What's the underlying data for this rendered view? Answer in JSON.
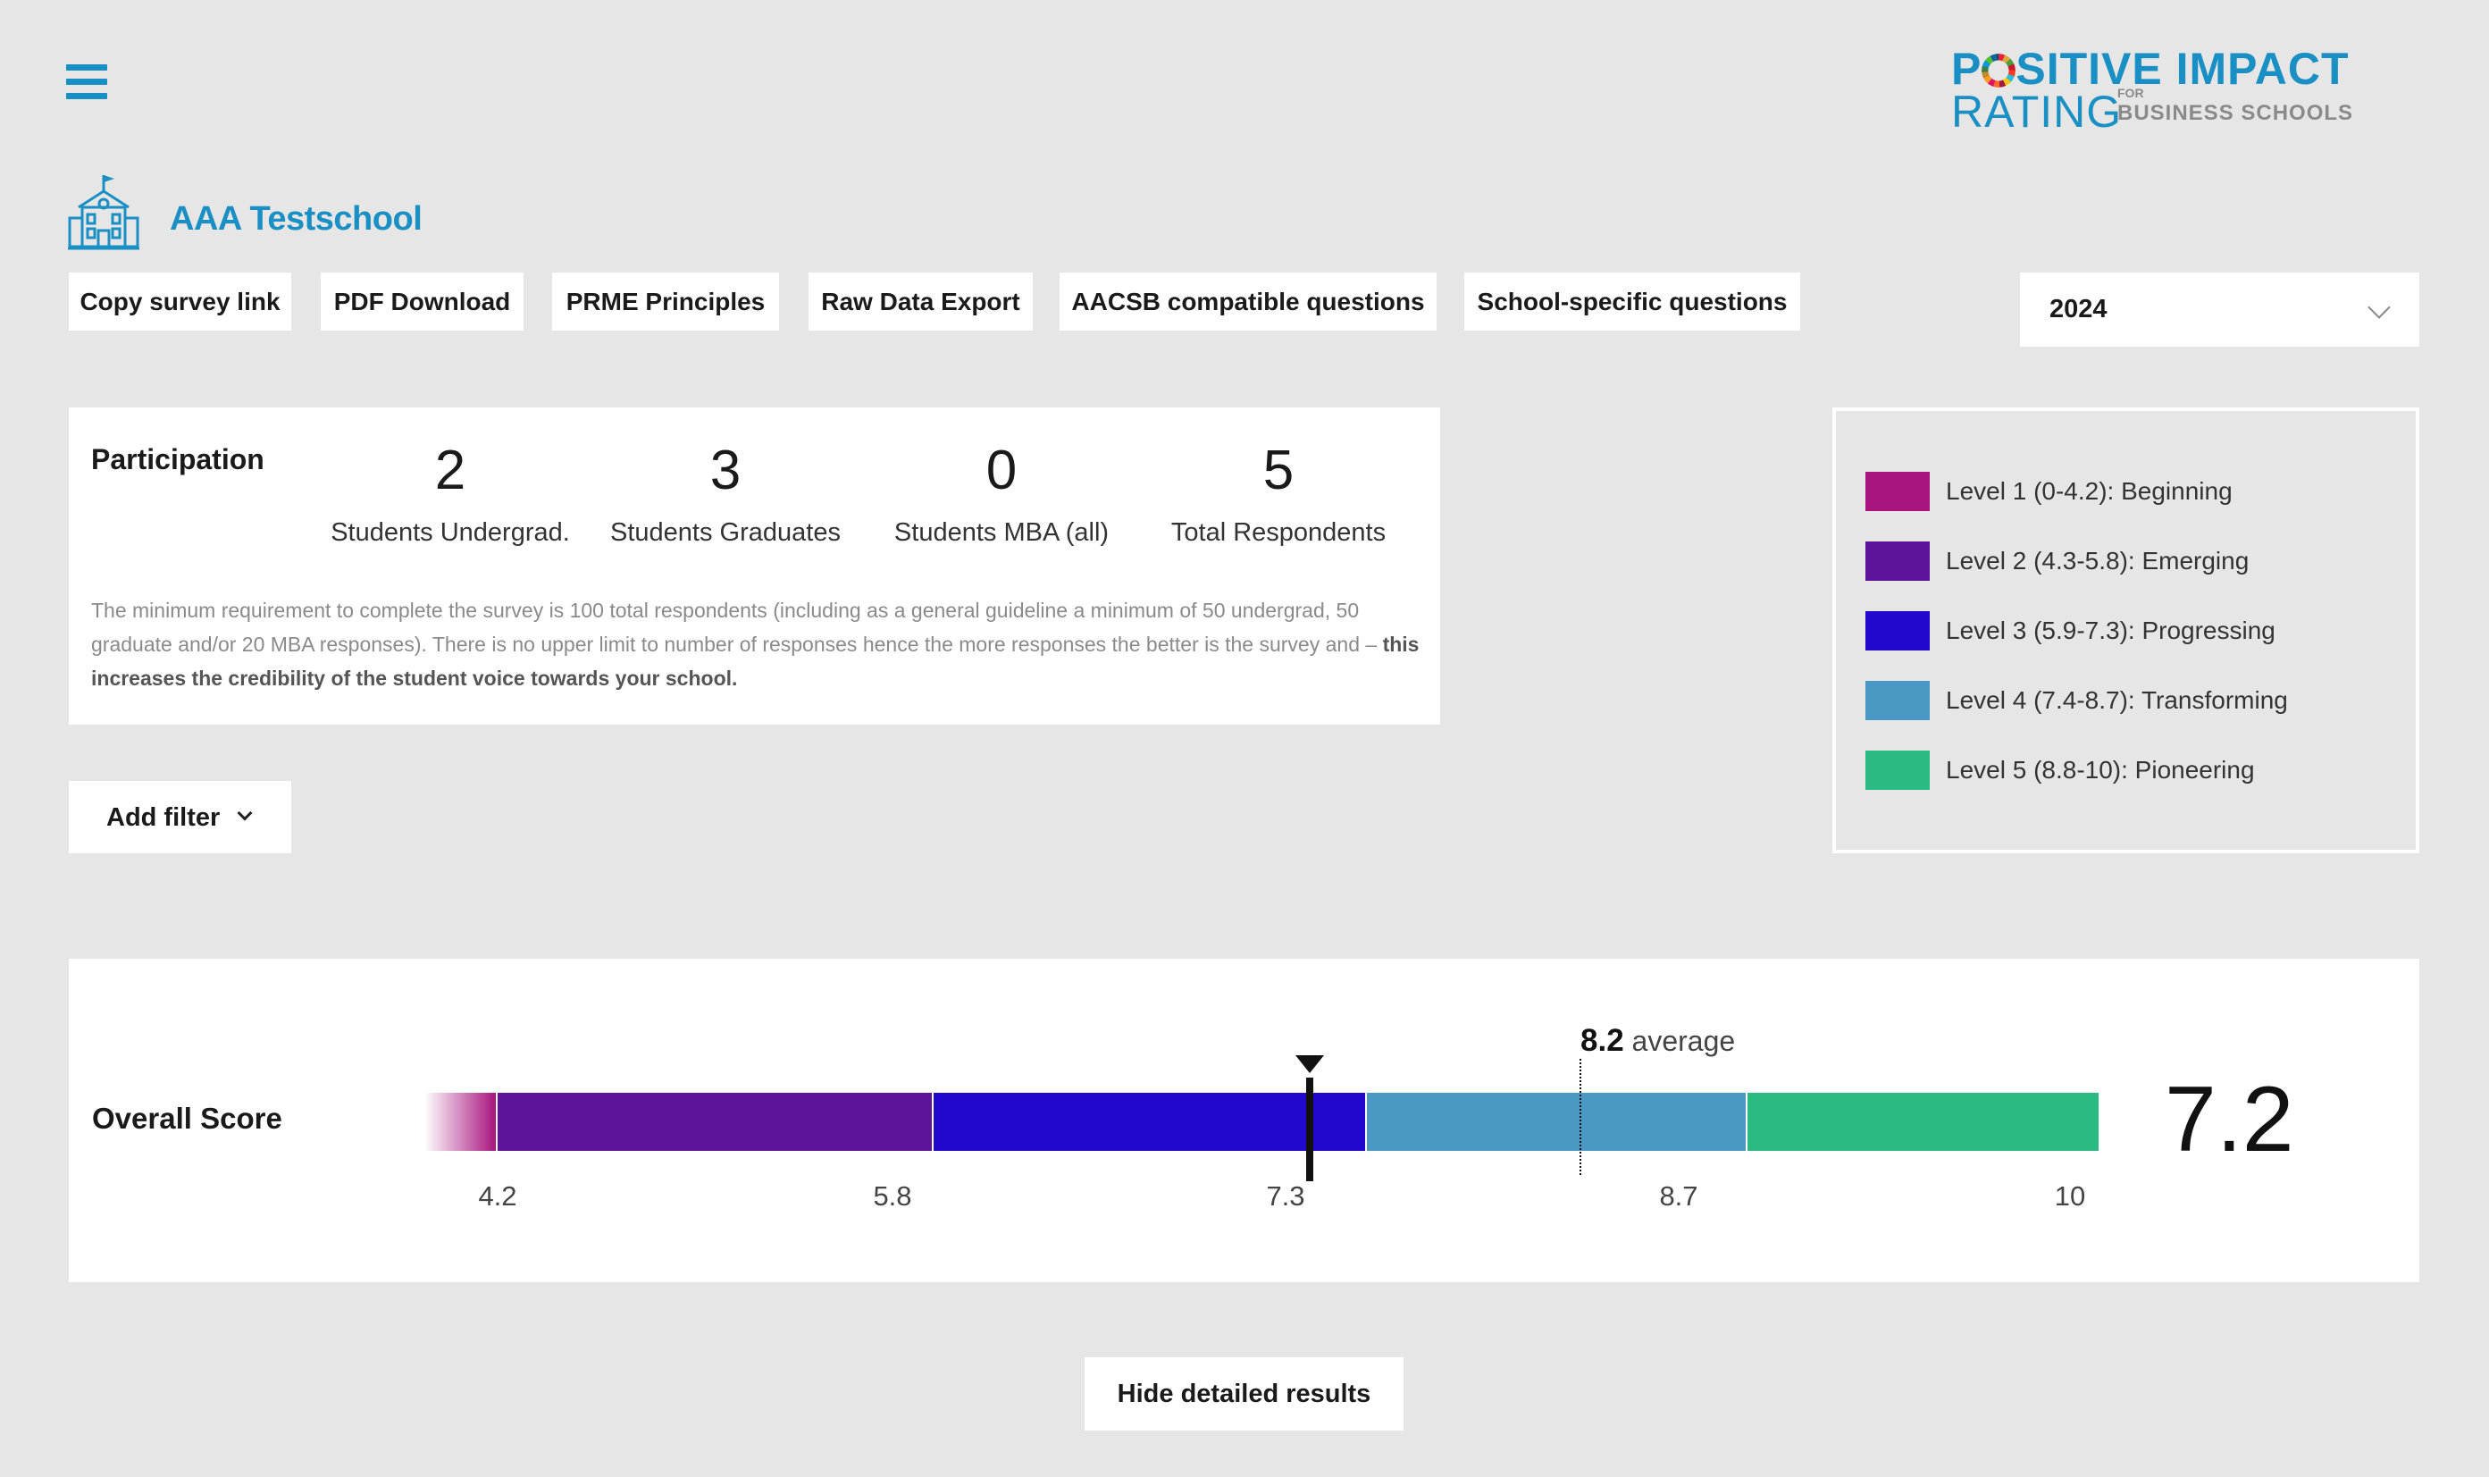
{
  "header": {
    "menu_icon": "hamburger-menu-icon",
    "logo": {
      "line1_a": "P",
      "line1_b": "SITIVE IMPACT",
      "line2": "RATING",
      "for": "FOR",
      "business_schools": "BUSINESS SCHOOLS"
    }
  },
  "school": {
    "icon": "school-building-icon",
    "name": "AAA Testschool"
  },
  "toolbar": {
    "buttons": [
      "Copy survey link",
      "PDF Download",
      "PRME Principles",
      "Raw Data Export",
      "AACSB compatible questions",
      "School-specific questions"
    ]
  },
  "year_select": {
    "value": "2024",
    "icon": "chevron-down-icon"
  },
  "participation": {
    "title": "Participation",
    "stats": [
      {
        "value": "2",
        "label": "Students Undergrad."
      },
      {
        "value": "3",
        "label": "Students Graduates"
      },
      {
        "value": "0",
        "label": "Students MBA (all)"
      },
      {
        "value": "5",
        "label": "Total Respondents"
      }
    ],
    "note_text": "The minimum requirement to complete the survey is 100 total respondents (including as a general guideline a minimum of 50 undergrad, 50 graduate and/or 20 MBA responses). There is no upper limit to number of responses hence the more responses the better is the survey and – ",
    "note_bold": "this increases the credibility of the student voice towards your school."
  },
  "legend": {
    "items": [
      {
        "label": "Level 1 (0-4.2): Beginning",
        "color": "#a8157e"
      },
      {
        "label": "Level 2 (4.3-5.8): Emerging",
        "color": "#5e139b"
      },
      {
        "label": "Level 3 (5.9-7.3): Progressing",
        "color": "#2208cc"
      },
      {
        "label": "Level 4 (7.4-8.7): Transforming",
        "color": "#4a98c3"
      },
      {
        "label": "Level 5 (8.8-10): Pioneering",
        "color": "#29bb82"
      }
    ]
  },
  "filter": {
    "label": "Add filter",
    "icon": "chevron-down-icon"
  },
  "overall_score": {
    "label": "Overall Score",
    "score": "7.2",
    "score_value": 7.2,
    "average_value": "8.2",
    "average_label": "average",
    "ticks": [
      "4.2",
      "5.8",
      "7.3",
      "8.7",
      "10"
    ]
  },
  "detail_toggle": {
    "label": "Hide detailed results"
  }
}
